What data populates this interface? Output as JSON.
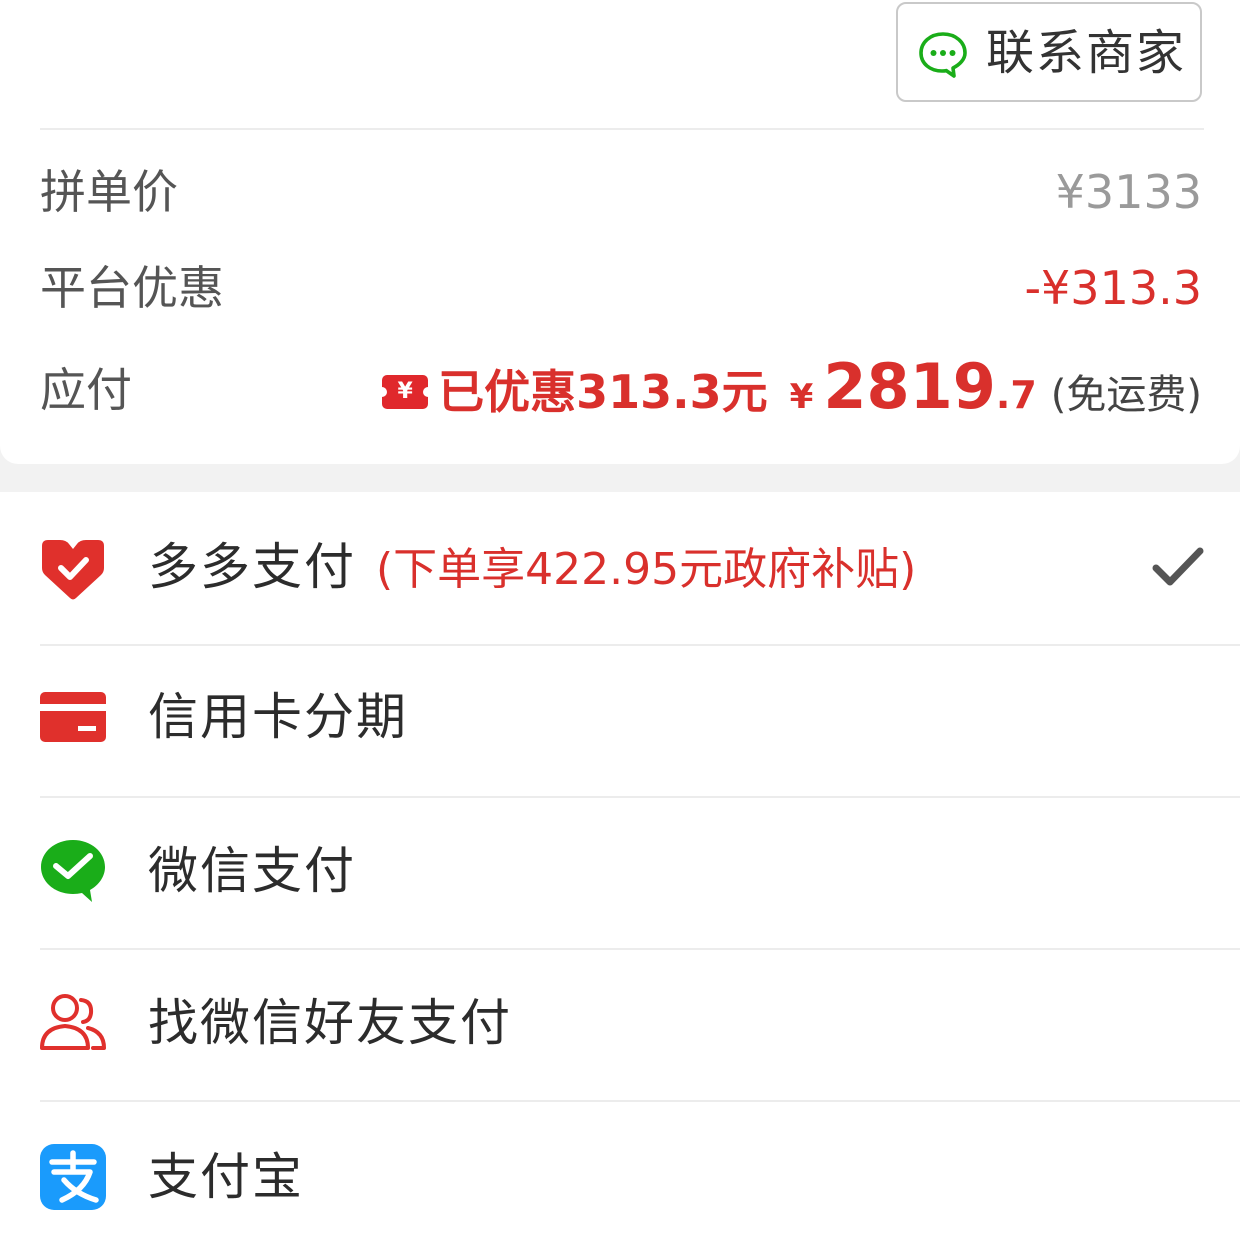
{
  "contact": {
    "label": "联系商家",
    "icon": "chat-bubble-icon"
  },
  "summary": {
    "original_label": "拼单价",
    "original_value": "¥3133",
    "discount_label": "平台优惠",
    "discount_value": "-¥313.3",
    "pay_label": "应付",
    "coupon_icon": "yen-coupon-icon",
    "coupon_glyph": "¥",
    "saved_text": "已优惠313.3元",
    "currency": "¥",
    "amount_int": "2819",
    "amount_dec": ".7",
    "freight_note": "(免运费)"
  },
  "payment_methods": [
    {
      "label": "多多支付",
      "note": "(下单享422.95元政府补贴)",
      "icon": "duoduo-pay-heart-icon",
      "selected": true
    },
    {
      "label": "信用卡分期",
      "icon": "credit-card-icon"
    },
    {
      "label": "微信支付",
      "icon": "wechat-pay-icon"
    },
    {
      "label": "找微信好友支付",
      "icon": "friends-icon"
    },
    {
      "label": "支付宝",
      "icon": "alipay-icon"
    }
  ],
  "colors": {
    "accent_red": "#d9302c",
    "wechat_green": "#1aad19",
    "alipay_blue": "#1a9bfc",
    "separator": "#ececec"
  }
}
